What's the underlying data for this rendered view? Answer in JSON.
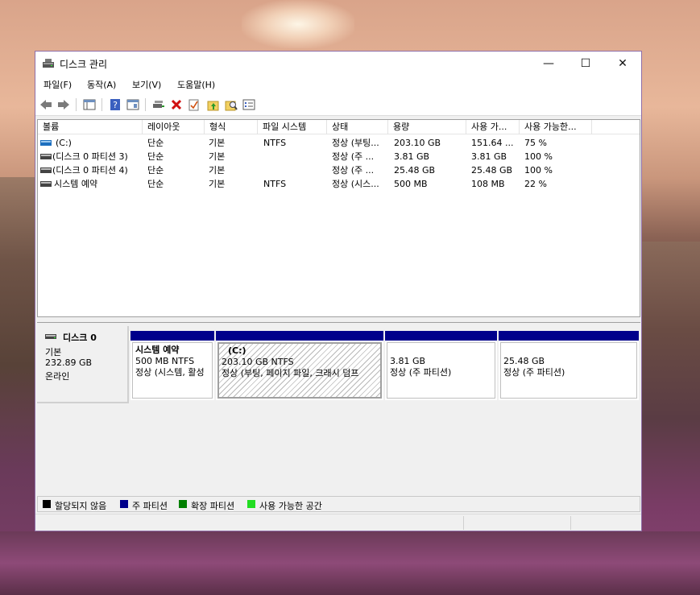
{
  "window": {
    "title": "디스크 관리",
    "controls": {
      "minimize": "—",
      "maximize": "☐",
      "close": "✕"
    }
  },
  "menu": [
    "파일(F)",
    "동작(A)",
    "보기(V)",
    "도움말(H)"
  ],
  "toolbar": [
    "back-icon",
    "forward-icon",
    "console-tree-icon",
    "help-icon",
    "properties-icon",
    "connect-icon",
    "delete-icon",
    "check-icon",
    "folder-up-icon",
    "search-folder-icon",
    "list-icon"
  ],
  "volume_table": {
    "columns": [
      "볼륨",
      "레이아웃",
      "형식",
      "파일 시스템",
      "상태",
      "용량",
      "사용 가...",
      "사용 가능한..."
    ],
    "rows": [
      [
        "(C:)",
        "단순",
        "기본",
        "NTFS",
        "정상 (부팅...",
        "203.10 GB",
        "151.64 ...",
        "75 %"
      ],
      [
        "(디스크 0 파티션 3)",
        "단순",
        "기본",
        "",
        "정상 (주 ...",
        "3.81 GB",
        "3.81 GB",
        "100 %"
      ],
      [
        "(디스크 0 파티션 4)",
        "단순",
        "기본",
        "",
        "정상 (주 ...",
        "25.48 GB",
        "25.48 GB",
        "100 %"
      ],
      [
        "시스템 예약",
        "단순",
        "기본",
        "NTFS",
        "정상 (시스...",
        "500 MB",
        "108 MB",
        "22 %"
      ]
    ]
  },
  "disk": {
    "name": "디스크 0",
    "type": "기본",
    "size": "232.89 GB",
    "status": "온라인",
    "partitions": [
      {
        "name": "시스템 예약",
        "size": "500 MB NTFS",
        "status": "정상 (시스템, 활성"
      },
      {
        "name": "(C:)",
        "size": "203.10 GB NTFS",
        "status": "정상 (부팅, 페이지 파일, 크래시 덤프"
      },
      {
        "name": "",
        "size": "3.81 GB",
        "status": "정상 (주 파티션)"
      },
      {
        "name": "",
        "size": "25.48 GB",
        "status": "정상 (주 파티션)"
      }
    ]
  },
  "legend": [
    {
      "label": "할당되지 않음",
      "color": "#000000"
    },
    {
      "label": "주 파티션",
      "color": "#00008b"
    },
    {
      "label": "확장 파티션",
      "color": "#008000"
    },
    {
      "label": "사용 가능한 공간",
      "color": "#22dd22"
    }
  ]
}
